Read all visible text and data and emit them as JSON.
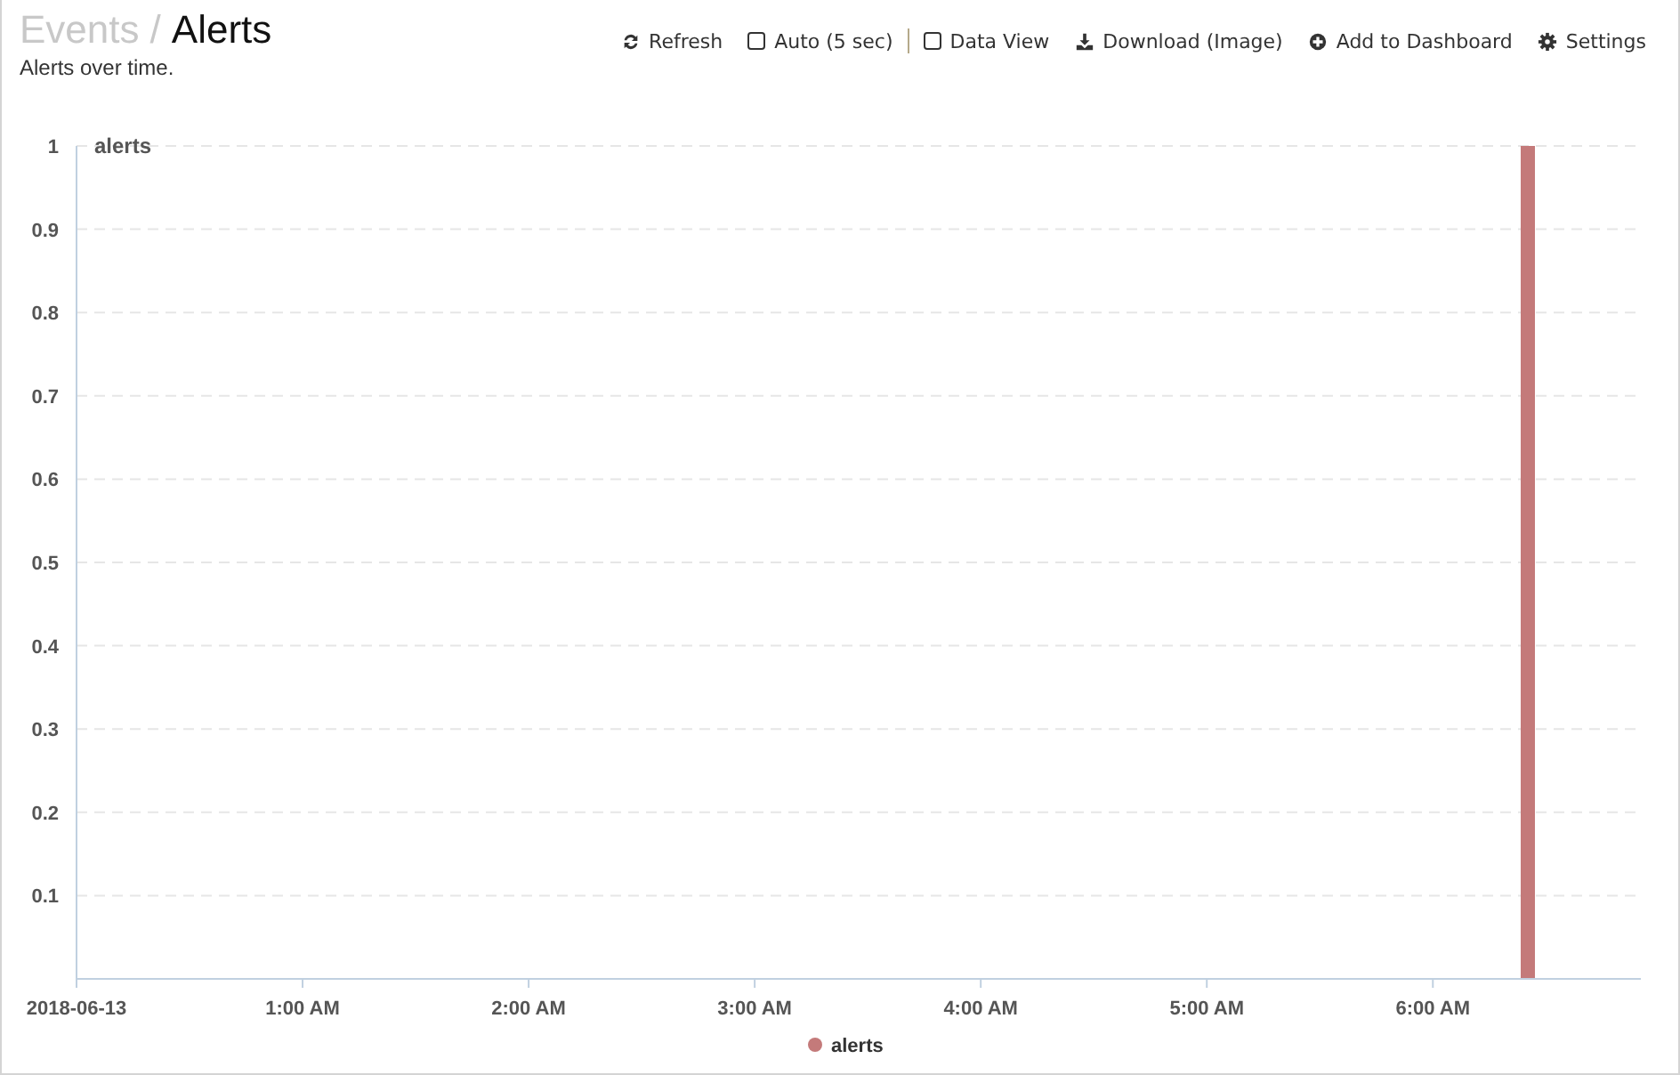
{
  "breadcrumb": {
    "parent": "Events",
    "separator": "/",
    "current": "Alerts"
  },
  "subtitle": "Alerts over time.",
  "toolbar": [
    {
      "kind": "refresh",
      "label": "Refresh"
    },
    {
      "kind": "checkbox",
      "label": "Auto (5 sec)",
      "checked": false
    },
    {
      "kind": "separator"
    },
    {
      "kind": "checkbox",
      "label": "Data View",
      "checked": false
    },
    {
      "kind": "download",
      "label": "Download (Image)"
    },
    {
      "kind": "add",
      "label": "Add to Dashboard"
    },
    {
      "kind": "settings",
      "label": "Settings"
    }
  ],
  "chart": {
    "chart_data": {
      "type": "bar",
      "grid": true,
      "ylabel": "alerts",
      "x": [
        6.42
      ],
      "series": [
        {
          "name": "alerts",
          "color": "#c47a7a",
          "values": [
            1
          ]
        }
      ],
      "xlim": [
        0,
        6.92
      ],
      "ylim": [
        0,
        1
      ],
      "xticks": [
        {
          "value": 0,
          "label": "2018-06-13"
        },
        {
          "value": 1,
          "label": "1:00 AM"
        },
        {
          "value": 2,
          "label": "2:00 AM"
        },
        {
          "value": 3,
          "label": "3:00 AM"
        },
        {
          "value": 4,
          "label": "4:00 AM"
        },
        {
          "value": 5,
          "label": "5:00 AM"
        },
        {
          "value": 6,
          "label": "6:00 AM"
        }
      ],
      "yticks": [
        0.1,
        0.2,
        0.3,
        0.4,
        0.5,
        0.6,
        0.7,
        0.8,
        0.9,
        1
      ]
    }
  }
}
